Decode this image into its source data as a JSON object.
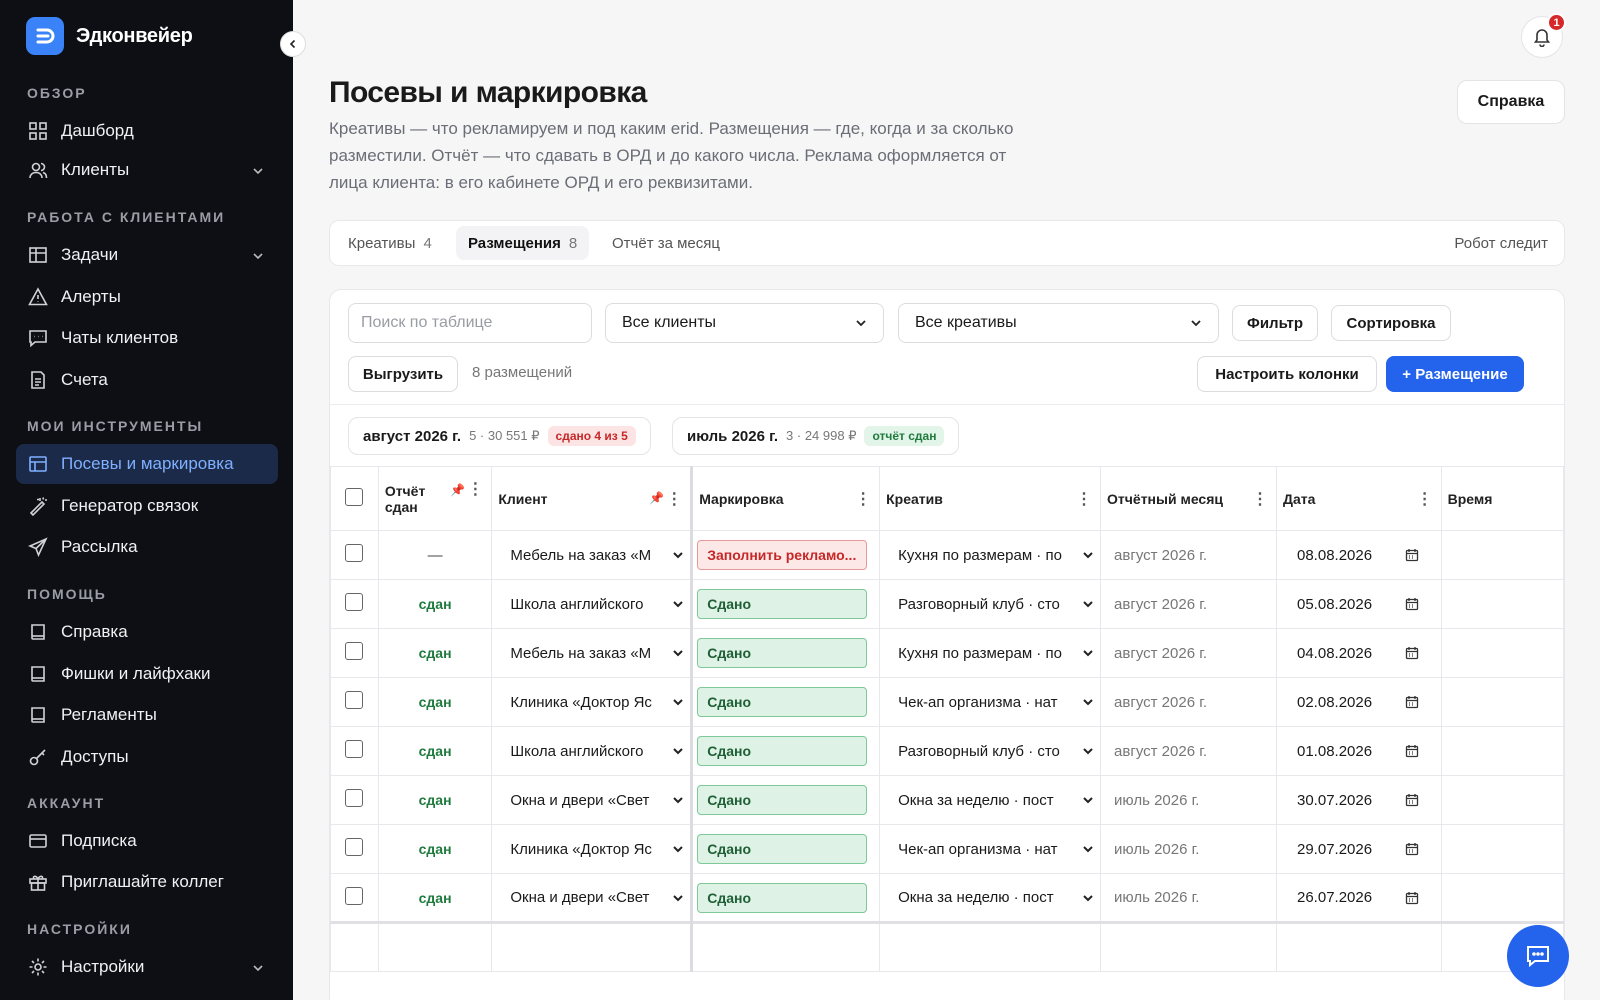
{
  "brand": {
    "name": "Эдконвейер"
  },
  "sidebar": {
    "sections": [
      {
        "title": "ОБЗОР"
      },
      {
        "title": "РАБОТА С КЛИЕНТАМИ"
      },
      {
        "title": "МОИ ИНСТРУМЕНТЫ"
      },
      {
        "title": "ПОМОЩЬ"
      },
      {
        "title": "АККАУНТ"
      },
      {
        "title": "НАСТРОЙКИ"
      }
    ],
    "items": [
      {
        "label": "Дашборд",
        "icon": "dashboard-icon"
      },
      {
        "label": "Клиенты",
        "icon": "users-icon"
      },
      {
        "label": "Задачи",
        "icon": "tasks-icon"
      },
      {
        "label": "Алерты",
        "icon": "alert-icon"
      },
      {
        "label": "Чаты клиентов",
        "icon": "chat-icon"
      },
      {
        "label": "Счета",
        "icon": "invoice-icon"
      },
      {
        "label": "Посевы и маркировка",
        "icon": "table-icon"
      },
      {
        "label": "Генератор связок",
        "icon": "magic-icon"
      },
      {
        "label": "Рассылка",
        "icon": "send-icon"
      },
      {
        "label": "Справка",
        "icon": "book-icon"
      },
      {
        "label": "Фишки и лайфхаки",
        "icon": "book-icon"
      },
      {
        "label": "Регламенты",
        "icon": "book-icon"
      },
      {
        "label": "Доступы",
        "icon": "key-icon"
      },
      {
        "label": "Подписка",
        "icon": "card-icon"
      },
      {
        "label": "Приглашайте коллег",
        "icon": "gift-icon"
      },
      {
        "label": "Настройки",
        "icon": "gear-icon"
      }
    ]
  },
  "header": {
    "notifications": "1",
    "title": "Посевы и маркировка",
    "description": "Креативы — что рекламируем и под каким erid. Размещения — где, когда и за сколько разместили. Отчёт — что сдавать в ОРД и до какого числа. Реклама оформляется от лица клиента: в его кабинете ОРД и его реквизитами.",
    "help_label": "Справка"
  },
  "tabs": [
    {
      "label": "Креативы",
      "count": "4"
    },
    {
      "label": "Размещения",
      "count": "8"
    },
    {
      "label": "Отчёт за месяц",
      "count": ""
    }
  ],
  "robot_label": "Робот следит",
  "toolbar": {
    "search_placeholder": "Поиск по таблице",
    "clients_select": "Все клиенты",
    "creatives_select": "Все креативы",
    "filter": "Фильтр",
    "sort": "Сортировка",
    "export": "Выгрузить",
    "count_text": "8 размещений",
    "columns": "Настроить колонки",
    "add": "+ Размещение"
  },
  "months": [
    {
      "label": "август 2026 г.",
      "meta": "5 · 30 551 ₽",
      "pill": "сдано 4 из 5",
      "pill_type": "red"
    },
    {
      "label": "июль 2026 г.",
      "meta": "3 · 24 998 ₽",
      "pill": "отчёт сдан",
      "pill_type": "green"
    }
  ],
  "table": {
    "headers": {
      "report": "Отчёт сдан",
      "client": "Клиент",
      "marking": "Маркировка",
      "creative": "Креатив",
      "month": "Отчётный месяц",
      "date": "Дата",
      "time": "Время"
    },
    "rows": [
      {
        "report": "—",
        "client": "Мебель на заказ «М",
        "marking": "Заполнить рекламо...",
        "marking_ok": false,
        "creative": "Кухня по размерам · по",
        "month": "август 2026 г.",
        "date": "08.08.2026"
      },
      {
        "report": "сдан",
        "client": "Школа английского",
        "marking": "Сдано",
        "marking_ok": true,
        "creative": "Разговорный клуб · сто",
        "month": "август 2026 г.",
        "date": "05.08.2026"
      },
      {
        "report": "сдан",
        "client": "Мебель на заказ «М",
        "marking": "Сдано",
        "marking_ok": true,
        "creative": "Кухня по размерам · по",
        "month": "август 2026 г.",
        "date": "04.08.2026"
      },
      {
        "report": "сдан",
        "client": "Клиника «Доктор Яс",
        "marking": "Сдано",
        "marking_ok": true,
        "creative": "Чек-ап организма · нат",
        "month": "август 2026 г.",
        "date": "02.08.2026"
      },
      {
        "report": "сдан",
        "client": "Школа английского",
        "marking": "Сдано",
        "marking_ok": true,
        "creative": "Разговорный клуб · сто",
        "month": "август 2026 г.",
        "date": "01.08.2026"
      },
      {
        "report": "сдан",
        "client": "Окна и двери «Свет",
        "marking": "Сдано",
        "marking_ok": true,
        "creative": "Окна за неделю · пост",
        "month": "июль 2026 г.",
        "date": "30.07.2026"
      },
      {
        "report": "сдан",
        "client": "Клиника «Доктор Яс",
        "marking": "Сдано",
        "marking_ok": true,
        "creative": "Чек-ап организма · нат",
        "month": "июль 2026 г.",
        "date": "29.07.2026"
      },
      {
        "report": "сдан",
        "client": "Окна и двери «Свет",
        "marking": "Сдано",
        "marking_ok": true,
        "creative": "Окна за неделю · пост",
        "month": "июль 2026 г.",
        "date": "26.07.2026"
      }
    ]
  },
  "colors": {
    "accent": "#2463eb",
    "sidebar_bg": "#0d0f14",
    "active_bg": "#1b2a48",
    "done": "#1f7a3d",
    "danger": "#c62828"
  }
}
